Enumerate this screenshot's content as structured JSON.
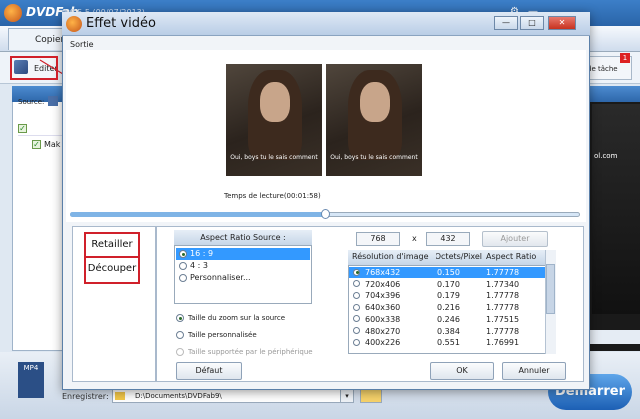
{
  "main_window": {
    "app_name": "DVDFab",
    "version_text": "9.0.5.5 (09/07/2013)",
    "tab_copy": "Copier",
    "edit_button": "Editer",
    "task_button": "de tâche",
    "task_badge": "1",
    "source_label": "Source:",
    "item_label": "Mak",
    "right_url": "ol.com",
    "save_label": "Enregistrer:",
    "save_path": "D:\\Documents\\DVDFab9\\",
    "start_button": "Démarrer",
    "mp4_badge": "MP4",
    "annotation_color": "#d0202a",
    "accent_color": "#2e67aa"
  },
  "dialog": {
    "title": "Effet vidéo",
    "minimize_glyph": "—",
    "maximize_glyph": "□",
    "close_glyph": "✕",
    "output_label": "Sortie",
    "subtitle_text": "Oui, boys tu le sais comment",
    "playback_time_label": "Temps de lecture(00:01:58)",
    "seek_progress": 0.5,
    "tabs": {
      "crop": "Retailler",
      "cut": "Découper"
    },
    "aspect_ratio_source": {
      "header": "Aspect Ratio Source :",
      "options": [
        "16 : 9",
        "4 : 3",
        "Personnaliser..."
      ],
      "selected": "16 : 9"
    },
    "width_value": "768",
    "times_sign": "x",
    "height_value": "432",
    "add_button": "Ajouter",
    "resolution_table": {
      "columns": [
        "Résolution d'image",
        "Octets/Pixel",
        "Aspect Ratio"
      ],
      "rows": [
        {
          "resolution": "768x432",
          "bpp": "0.150",
          "ratio": "1.77778",
          "selected": true
        },
        {
          "resolution": "720x406",
          "bpp": "0.170",
          "ratio": "1.77340",
          "selected": false
        },
        {
          "resolution": "704x396",
          "bpp": "0.179",
          "ratio": "1.77778",
          "selected": false
        },
        {
          "resolution": "640x360",
          "bpp": "0.216",
          "ratio": "1.77778",
          "selected": false
        },
        {
          "resolution": "600x338",
          "bpp": "0.246",
          "ratio": "1.77515",
          "selected": false
        },
        {
          "resolution": "480x270",
          "bpp": "0.384",
          "ratio": "1.77778",
          "selected": false
        },
        {
          "resolution": "400x226",
          "bpp": "0.551",
          "ratio": "1.76991",
          "selected": false
        }
      ]
    },
    "zoom_options": [
      {
        "label": "Taille du zoom sur la source",
        "selected": true,
        "disabled": false
      },
      {
        "label": "Taille personnalisée",
        "selected": false,
        "disabled": false
      },
      {
        "label": "Taille supportée par le périphérique",
        "selected": false,
        "disabled": true
      }
    ],
    "default_button": "Défaut",
    "ok_button": "OK",
    "cancel_button": "Annuler"
  }
}
